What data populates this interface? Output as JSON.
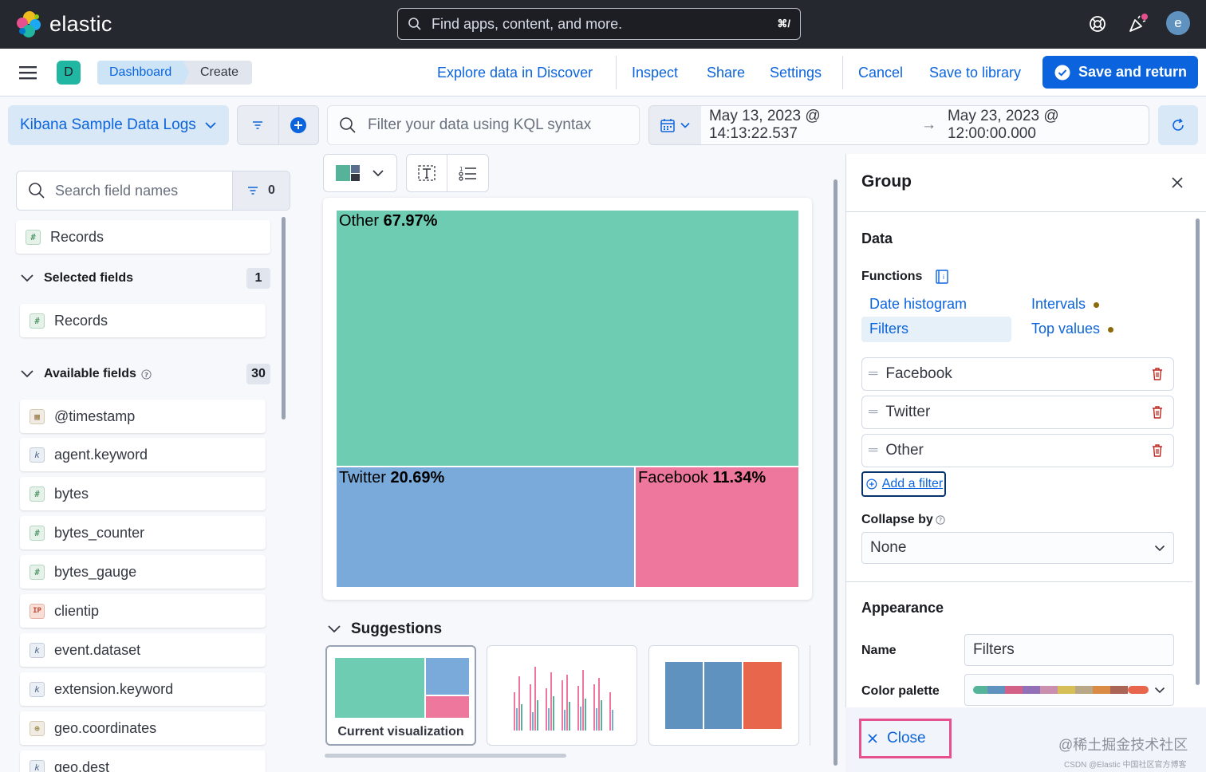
{
  "header": {
    "brand": "elastic",
    "search_placeholder": "Find apps, content, and more.",
    "search_shortcut": "⌘/",
    "avatar_initial": "e"
  },
  "appbar": {
    "space_initial": "D",
    "breadcrumbs": [
      "Dashboard",
      "Create"
    ],
    "links": {
      "explore": "Explore data in Discover",
      "inspect": "Inspect",
      "share": "Share",
      "settings": "Settings",
      "cancel": "Cancel",
      "save_library": "Save to library"
    },
    "save_return": "Save and return"
  },
  "querybar": {
    "data_view": "Kibana Sample Data Logs",
    "kql_placeholder": "Filter your data using KQL syntax",
    "date_start": "May 13, 2023 @ 14:13:22.537",
    "date_arrow": "→",
    "date_end": "May 23, 2023 @ 12:00:00.000"
  },
  "sidebar": {
    "search_placeholder": "Search field names",
    "filter_count": "0",
    "records_top": "Records",
    "selected_label": "Selected fields",
    "selected_count": "1",
    "selected_items": [
      "Records"
    ],
    "available_label": "Available fields",
    "available_count": "30",
    "available_items": [
      {
        "name": "@timestamp",
        "type": "date"
      },
      {
        "name": "agent.keyword",
        "type": "keyword"
      },
      {
        "name": "bytes",
        "type": "number"
      },
      {
        "name": "bytes_counter",
        "type": "number"
      },
      {
        "name": "bytes_gauge",
        "type": "number"
      },
      {
        "name": "clientip",
        "type": "ip"
      },
      {
        "name": "event.dataset",
        "type": "keyword"
      },
      {
        "name": "extension.keyword",
        "type": "keyword"
      },
      {
        "name": "geo.coordinates",
        "type": "geo"
      },
      {
        "name": "geo.dest",
        "type": "keyword"
      }
    ]
  },
  "treemap": {
    "cells": [
      {
        "name": "Other",
        "percent": "67.97%",
        "color": "#6dccb1"
      },
      {
        "name": "Twitter",
        "percent": "20.69%",
        "color": "#79aad9"
      },
      {
        "name": "Facebook",
        "percent": "11.34%",
        "color": "#ee789d"
      }
    ]
  },
  "suggestions": {
    "title": "Suggestions",
    "current_label": "Current visualization"
  },
  "flyout": {
    "title": "Group",
    "data_label": "Data",
    "functions_label": "Functions",
    "functions": [
      "Date histogram",
      "Intervals",
      "Filters",
      "Top values"
    ],
    "filters": [
      "Facebook",
      "Twitter",
      "Other"
    ],
    "add_filter": "Add a filter",
    "collapse_label": "Collapse by",
    "collapse_value": "None",
    "appearance_label": "Appearance",
    "name_label": "Name",
    "name_value": "Filters",
    "palette_label": "Color palette",
    "close_label": "Close"
  },
  "watermark": {
    "line1": "@稀土掘金技术社区",
    "line2": "CSDN @Elastic 中国社区官方博客"
  },
  "colors": {
    "primary": "#0b64dd",
    "header_bg": "#25282f",
    "highlight": "#e7508f"
  }
}
